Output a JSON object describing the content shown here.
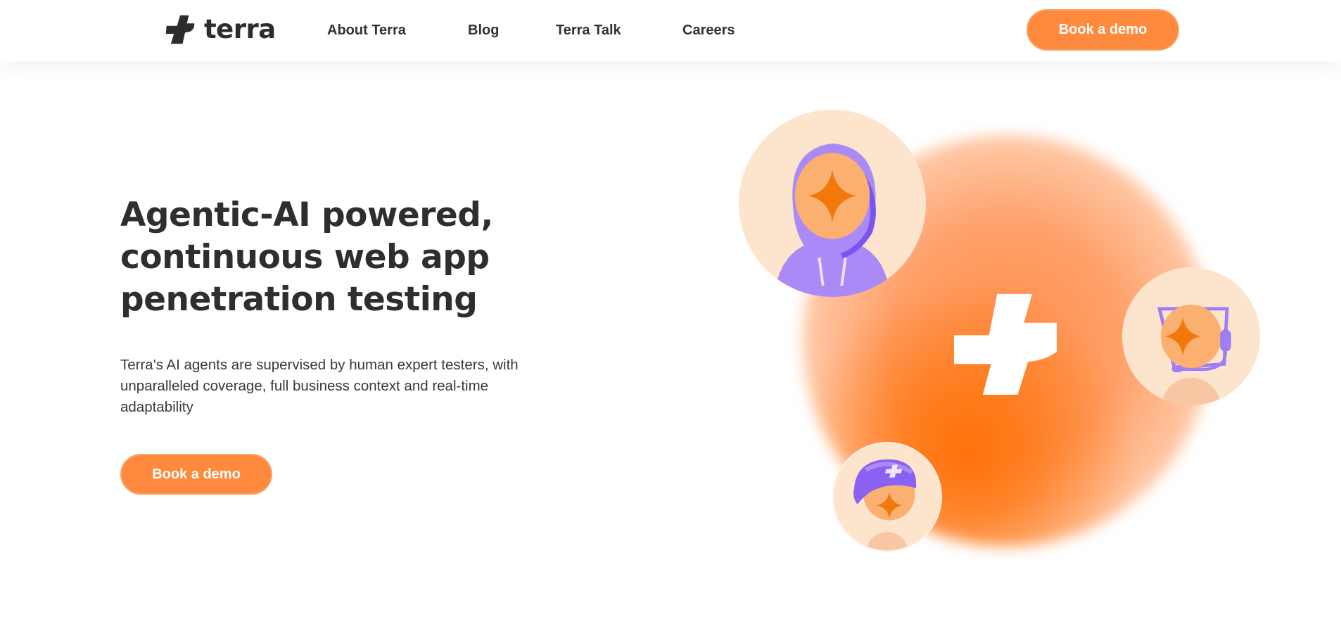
{
  "brand": {
    "name": "terra",
    "logo_icon": "terra-cross-mark",
    "colors": {
      "accent": "#ff8a3d",
      "text": "#2f2d2d",
      "avatar_bg": "#fde5cd",
      "purple": "#9e7df5"
    }
  },
  "nav": {
    "links": [
      {
        "label": "About Terra"
      },
      {
        "label": "Blog"
      },
      {
        "label": "Terra Talk"
      },
      {
        "label": "Careers"
      }
    ],
    "cta_label": "Book a demo"
  },
  "hero": {
    "title": "Agentic-AI powered, continuous web app penetration testing",
    "subtitle": "Terra's AI agents are supervised by human expert testers, with unparalleled coverage, full business context and real-time adaptability",
    "cta_label": "Book a demo",
    "illustration": {
      "center_icon": "terra-cross-mark",
      "avatars": [
        "hooded-agent-avatar",
        "headset-agent-avatar",
        "cap-agent-avatar"
      ]
    }
  }
}
